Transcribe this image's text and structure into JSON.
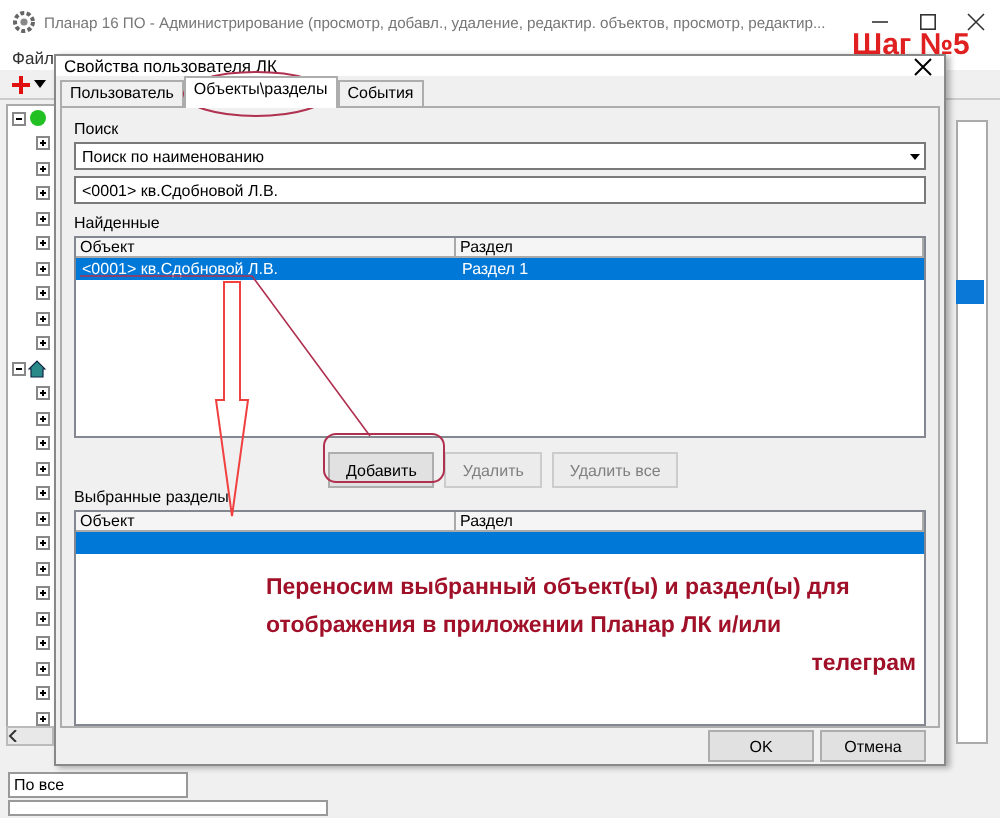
{
  "window": {
    "title": "Планар 16 ПО - Администрирование (просмотр, добавл., удаление, редактир. объектов,  просмотр, редактир..."
  },
  "menu": [
    "Файл"
  ],
  "tree": [
    {
      "kind": "online",
      "expanded": true,
      "children": [
        {
          "expanded": false
        },
        {
          "expanded": false
        },
        {
          "expanded": false
        },
        {
          "expanded": false
        },
        {
          "expanded": false
        },
        {
          "expanded": false
        },
        {
          "expanded": false
        },
        {
          "expanded": false
        },
        {
          "expanded": false
        }
      ]
    },
    {
      "kind": "site",
      "expanded": true,
      "children": [
        {
          "expanded": false
        },
        {
          "expanded": false
        },
        {
          "expanded": false
        },
        {
          "expanded": false
        },
        {
          "expanded": false
        },
        {
          "expanded": false
        },
        {
          "expanded": false
        },
        {
          "expanded": false
        },
        {
          "expanded": false
        },
        {
          "expanded": false
        },
        {
          "expanded": false
        },
        {
          "expanded": false
        },
        {
          "expanded": false
        },
        {
          "expanded": false
        }
      ]
    }
  ],
  "filter_field": {
    "value": "По все"
  },
  "dialog": {
    "title": "Свойства пользователя ЛК",
    "tabs": [
      {
        "label": "Пользователь",
        "selected": false
      },
      {
        "label": "Объекты\\разделы",
        "selected": true
      },
      {
        "label": "События",
        "selected": false
      }
    ],
    "search_label": "Поиск",
    "search_mode": "Поиск по наименованию",
    "search_value": "<0001> кв.Сдобновой Л.В.",
    "found_label": "Найденные",
    "found_table": {
      "columns": [
        "Объект",
        "Раздел"
      ],
      "rows": [
        {
          "cells": [
            "<0001> кв.Сдобновой Л.В.",
            "Раздел 1"
          ],
          "selected": true
        }
      ]
    },
    "buttons": [
      {
        "label": "Добавить",
        "disabled": false
      },
      {
        "label": "Удалить",
        "disabled": true
      },
      {
        "label": "Удалить все",
        "disabled": true
      }
    ],
    "selected_label": "Выбранные разделы",
    "selected_table": {
      "columns": [
        "Объект",
        "Раздел"
      ],
      "rows": [
        {
          "selected": true
        }
      ]
    },
    "footer_buttons": [
      "OK",
      "Отмена"
    ]
  },
  "annotations": {
    "step": "Шаг №5",
    "note_lines": [
      "Переносим выбранный объект(ы) и раздел(ы) для",
      "отображения в приложении Планар ЛК и/или",
      "телеграм"
    ]
  }
}
